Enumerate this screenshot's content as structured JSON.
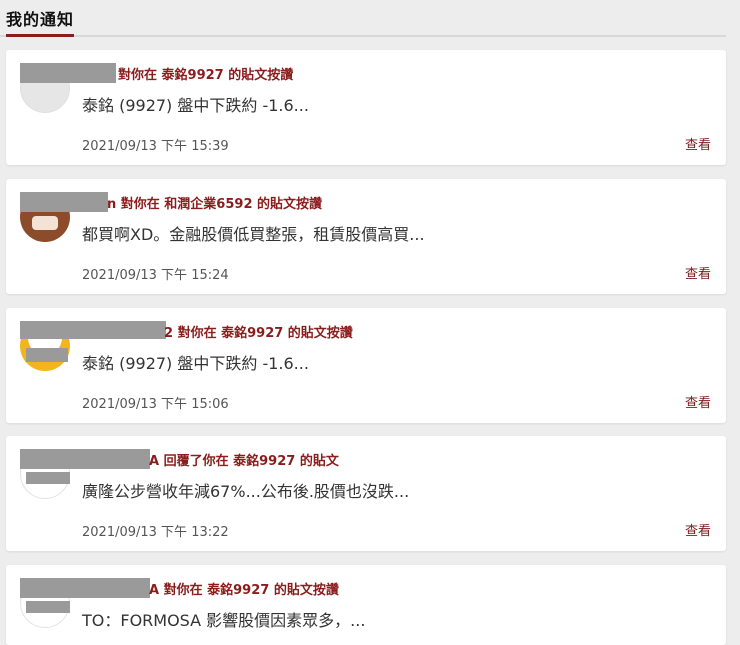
{
  "page": {
    "title": "我的通知",
    "accent_color": "#8a1c1c",
    "background": "#ededed"
  },
  "notifications": [
    {
      "headline_visible": "對你在 泰銘9927 的貼文按讚",
      "snippet": "泰銘 (9927) 盤中下跌約 -1.6...",
      "time": "2021/09/13 下午 15:39",
      "action": "查看",
      "avatar": "gray"
    },
    {
      "headline_visible": "n 對你在 和潤企業6592 的貼文按讚",
      "snippet": "都買啊XD。金融股價低買整張，租賃股價高買...",
      "time": "2021/09/13 下午 15:24",
      "action": "查看",
      "avatar": "brown"
    },
    {
      "headline_visible": "2 對你在 泰銘9927 的貼文按讚",
      "snippet": "泰銘 (9927) 盤中下跌約 -1.6...",
      "time": "2021/09/13 下午 15:06",
      "action": "查看",
      "avatar": "yellow"
    },
    {
      "headline_visible": "A 回覆了你在 泰銘9927 的貼文",
      "snippet": "廣隆公步營收年減67%...公布後.股價也沒跌...",
      "time": "2021/09/13 下午 13:22",
      "action": "查看",
      "avatar": "white"
    },
    {
      "headline_visible": "A 對你在 泰銘9927 的貼文按讚",
      "snippet": "TO：FORMOSA 影響股價因素眾多，...",
      "avatar": "white"
    }
  ]
}
